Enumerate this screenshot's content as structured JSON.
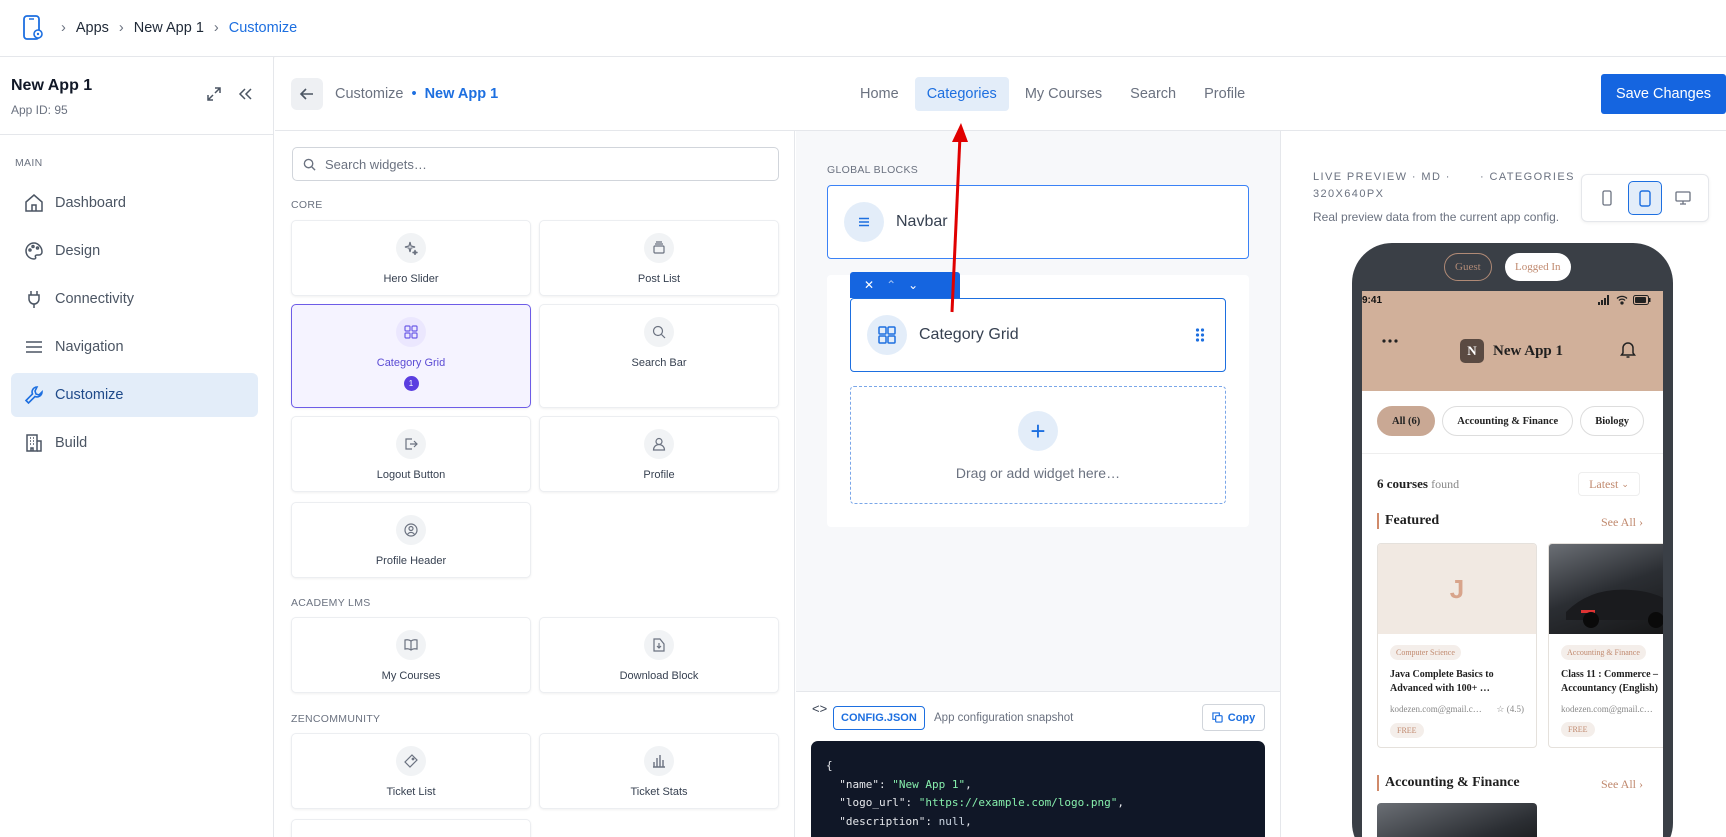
{
  "breadcrumb": {
    "items": [
      "Apps",
      "New App 1",
      "Customize"
    ]
  },
  "sidebar": {
    "app_title": "New App 1",
    "app_id": "App ID: 95",
    "section": "MAIN",
    "items": [
      {
        "label": "Dashboard",
        "icon": "home-icon"
      },
      {
        "label": "Design",
        "icon": "palette-icon"
      },
      {
        "label": "Connectivity",
        "icon": "plug-icon"
      },
      {
        "label": "Navigation",
        "icon": "menu-icon"
      },
      {
        "label": "Customize",
        "icon": "wrench-icon",
        "selected": true
      },
      {
        "label": "Build",
        "icon": "building-icon"
      }
    ]
  },
  "header": {
    "crumb_label": "Customize",
    "crumb_app": "New App 1",
    "tabs": [
      "Home",
      "Categories",
      "My Courses",
      "Search",
      "Profile"
    ],
    "selected_tab": "Categories",
    "save_label": "Save Changes"
  },
  "widgets": {
    "search_placeholder": "Search widgets…",
    "groups": [
      "CORE",
      "ACADEMY LMS",
      "ZENCOMMUNITY"
    ],
    "items": [
      {
        "label": "Hero Slider",
        "icon": "sparkle-icon"
      },
      {
        "label": "Post List",
        "icon": "stack-icon"
      },
      {
        "label": "Category Grid",
        "icon": "grid-icon",
        "selected": true,
        "badge": "1"
      },
      {
        "label": "Search Bar",
        "icon": "search-icon"
      },
      {
        "label": "Logout Button",
        "icon": "logout-icon"
      },
      {
        "label": "Profile",
        "icon": "user-icon"
      },
      {
        "label": "Profile Header",
        "icon": "user-circle-icon"
      },
      {
        "label": "My Courses",
        "icon": "book-icon"
      },
      {
        "label": "Download Block",
        "icon": "download-icon"
      },
      {
        "label": "Ticket List",
        "icon": "ticket-icon"
      },
      {
        "label": "Ticket Stats",
        "icon": "bar-chart-icon"
      }
    ]
  },
  "canvas": {
    "global_label": "GLOBAL BLOCKS",
    "navbar_label": "Navbar",
    "block_label": "Category Grid",
    "drop_label": "Drag or add widget here…"
  },
  "config": {
    "code_glyph": "<>",
    "tag": "CONFIG.JSON",
    "subtitle": "App configuration snapshot",
    "copy_label": "Copy",
    "lines": [
      {
        "key": "\"name\"",
        "value": "\"New App 1\"",
        "kind": "s"
      },
      {
        "key": "\"logo_url\"",
        "value": "\"https://example.com/logo.png\"",
        "kind": "s"
      },
      {
        "key": "\"description\"",
        "value": "null",
        "kind": "n"
      }
    ]
  },
  "preview": {
    "title": "LIVE PREVIEW · MD · 320X640PX",
    "category": "· CATEGORIES",
    "subtitle": "Real preview data from the current app config.",
    "guest_label": "Guest",
    "logged_in_label": "Logged In",
    "time": "9:41",
    "app_logo_letter": "N",
    "app_name": "New App 1",
    "chips": [
      "All (6)",
      "Accounting & Finance",
      "Biology"
    ],
    "count_text": "6 courses",
    "found_text": "found",
    "sort_label": "Latest",
    "featured_title": "Featured",
    "see_all": "See All",
    "section2_title": "Accounting & Finance",
    "courses": [
      {
        "letter": "J",
        "category": "Computer Science",
        "title": "Java Complete Basics to Advanced with 100+ …",
        "author": "kodezen.com@gmail.c…",
        "rating": "(4.5)",
        "price": "FREE"
      },
      {
        "letter": "",
        "category": "Accounting & Finance",
        "title": "Class 11 : Commerce – Accountancy (English)",
        "author": "kodezen.com@gmail.c…",
        "rating": "",
        "price": "FREE"
      }
    ]
  },
  "colors": {
    "accent": "#1565e0",
    "selected_widget": "#6d5ce7",
    "app_header": "#d1b09a",
    "annotation_arrow": "#e00000"
  }
}
